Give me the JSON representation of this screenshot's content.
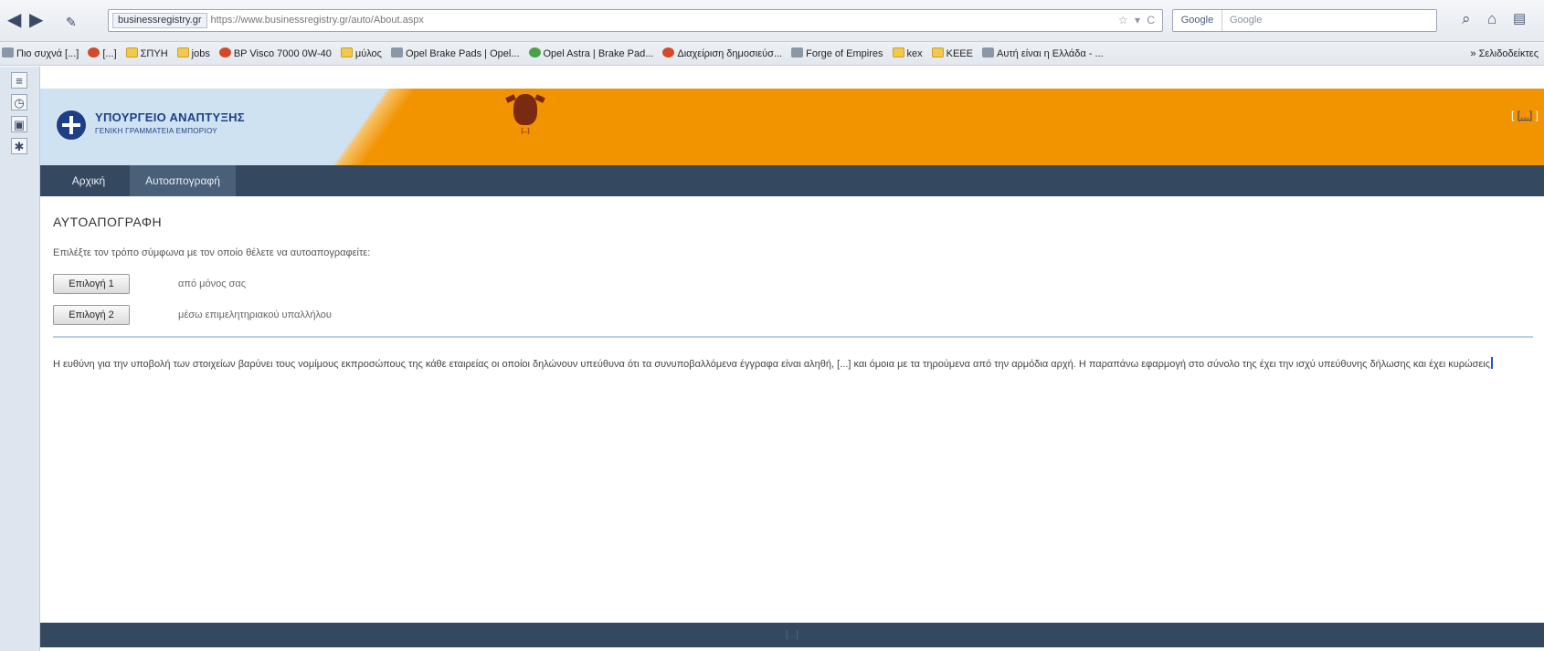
{
  "browser": {
    "url_site_badge": "businessregistry.gr",
    "url": "https://www.businessregistry.gr/auto/About.aspx",
    "search_engine": "Google",
    "search_placeholder": "Google",
    "url_actions": "☆ ▾ C",
    "back_glyph": "◀",
    "forward_glyph": "▶",
    "back_icon": "back-arrow-icon",
    "forward_icon": "forward-arrow-icon"
  },
  "bookmarks": {
    "items": [
      {
        "label": "Πιο συχνά [...]",
        "icon": "page"
      },
      {
        "label": "[...]",
        "icon": "red"
      },
      {
        "label": "ΣΠΥΗ",
        "icon": "folder"
      },
      {
        "label": "jobs",
        "icon": "folder"
      },
      {
        "label": "BP Visco 7000 0W-40",
        "icon": "red"
      },
      {
        "label": "μύλος",
        "icon": "folder"
      },
      {
        "label": "Opel Brake Pads | Opel...",
        "icon": "page"
      },
      {
        "label": "Opel Astra | Brake Pad...",
        "icon": "green"
      },
      {
        "label": "Διαχείριση δημοσιεύσ...",
        "icon": "red"
      },
      {
        "label": "Forge of Empires",
        "icon": "page"
      },
      {
        "label": "kex",
        "icon": "folder"
      },
      {
        "label": "ΚΕΕΕ",
        "icon": "folder"
      },
      {
        "label": "Αυτή είναι η Ελλάδα - ...",
        "icon": "page"
      }
    ],
    "right_label": "» Σελιδοδείκτες"
  },
  "sidebar_icons": [
    "bookmarks-sidebar-icon",
    "history-icon",
    "tabs-icon",
    "addons-icon"
  ],
  "header": {
    "ministry_name": "ΥΠΟΥΡΓΕΙΟ ΑΝΑΠΤΥΞΗΣ",
    "ministry_sub": "ΓΕΝΙΚΗ ΓΡΑΜΜΑΤΕΙΑ ΕΜΠΟΡΙΟΥ",
    "registry_logo_text": "[...]",
    "login_open": "[ ",
    "login_label": "[...]",
    "login_close": " ]"
  },
  "menu": {
    "items": [
      {
        "label": "Αρχική"
      },
      {
        "label": "Αυτοαπογραφή"
      }
    ]
  },
  "main": {
    "title": "ΑΥΤΟΑΠΟΓΡΑΦΗ",
    "instruction": "Επιλέξτε τον τρόπο σύμφωνα με τον οποίο θέλετε να αυτοαπογραφείτε:",
    "options": [
      {
        "button_label": "Επιλογή 1",
        "description": "από μόνος σας"
      },
      {
        "button_label": "Επιλογή 2",
        "description": "μέσω επιμελητηριακού υπαλλήλου"
      }
    ],
    "disclaimer": "Η ευθύνη για την υποβολή των στοιχείων βαρύνει τους νομίμους εκπροσώπους της κάθε εταιρείας οι οποίοι δηλώνουν υπεύθυνα ότι τα συνυποβαλλόμενα έγγραφα είναι αληθή, [...] και όμοια με τα τηρούμενα από την αρμόδια αρχή. Η παραπάνω εφαρμογή στο σύνολο της έχει την ισχύ υπεύθυνης δήλωσης και έχει κυρώσεις"
  },
  "footer": {
    "text": "[...]"
  },
  "colors": {
    "banner_orange": "#f29400",
    "banner_blue": "#cfe2f2",
    "menu_bg": "#344960",
    "ministry_blue": "#1d3f86"
  }
}
